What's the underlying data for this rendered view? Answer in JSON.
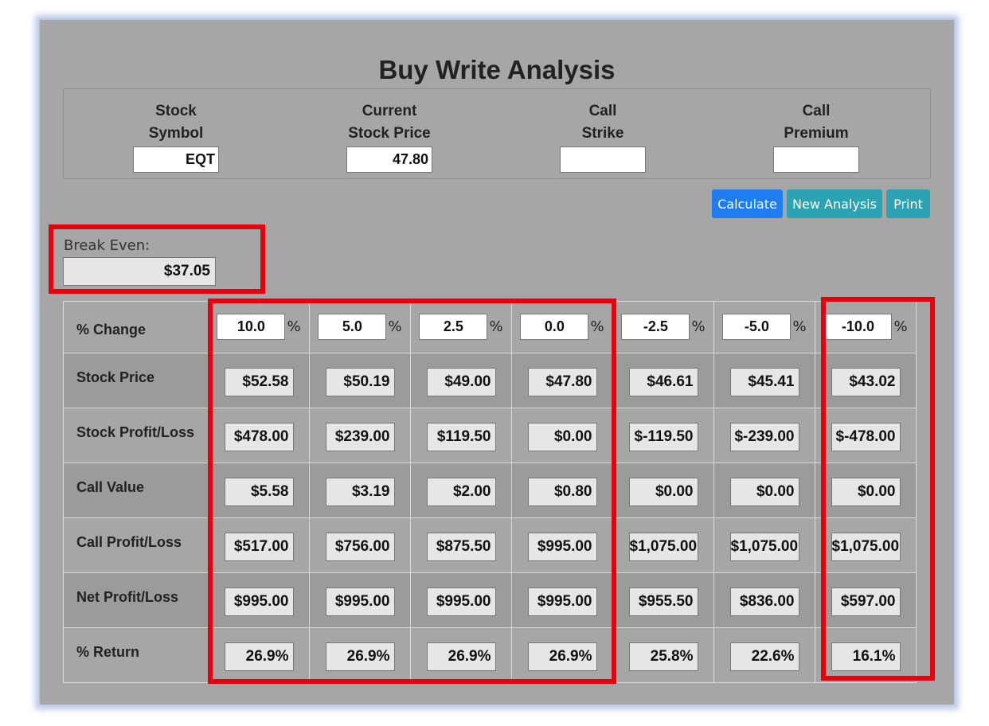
{
  "title": "Buy Write Analysis",
  "inputs": {
    "stock_symbol": {
      "label_line1": "Stock",
      "label_line2": "Symbol",
      "value": "EQT"
    },
    "current_price": {
      "label_line1": "Current",
      "label_line2": "Stock Price",
      "value": "47.80"
    },
    "call_strike": {
      "label_line1": "Call",
      "label_line2": "Strike",
      "value": ""
    },
    "call_premium": {
      "label_line1": "Call",
      "label_line2": "Premium",
      "value": ""
    }
  },
  "buttons": {
    "calculate": "Calculate",
    "new_analysis": "New Analysis",
    "print": "Print"
  },
  "break_even": {
    "label": "Break Even:",
    "value": "$37.05"
  },
  "percent_symbol": "%",
  "table": {
    "row_labels": [
      "% Change",
      "Stock Price",
      "Stock Profit/Loss",
      "Call Value",
      "Call Profit/Loss",
      "Net Profit/Loss",
      "% Return"
    ],
    "pct_change": [
      "10.0",
      "5.0",
      "2.5",
      "0.0",
      "-2.5",
      "-5.0",
      "-10.0"
    ],
    "stock_price": [
      "$52.58",
      "$50.19",
      "$49.00",
      "$47.80",
      "$46.61",
      "$45.41",
      "$43.02"
    ],
    "stock_pl": [
      "$478.00",
      "$239.00",
      "$119.50",
      "$0.00",
      "$-119.50",
      "$-239.00",
      "$-478.00"
    ],
    "call_value": [
      "$5.58",
      "$3.19",
      "$2.00",
      "$0.80",
      "$0.00",
      "$0.00",
      "$0.00"
    ],
    "call_pl": [
      "$517.00",
      "$756.00",
      "$875.50",
      "$995.00",
      "$1,075.00",
      "$1,075.00",
      "$1,075.00"
    ],
    "net_pl": [
      "$995.00",
      "$995.00",
      "$995.00",
      "$995.00",
      "$955.50",
      "$836.00",
      "$597.00"
    ],
    "pct_return": [
      "26.9%",
      "26.9%",
      "26.9%",
      "26.9%",
      "25.8%",
      "22.6%",
      "16.1%"
    ]
  },
  "colors": {
    "highlight": "#e8000d",
    "calculate": "#1e7df0",
    "secondary": "#2ba3b3",
    "panel": "#a6a6a6"
  }
}
